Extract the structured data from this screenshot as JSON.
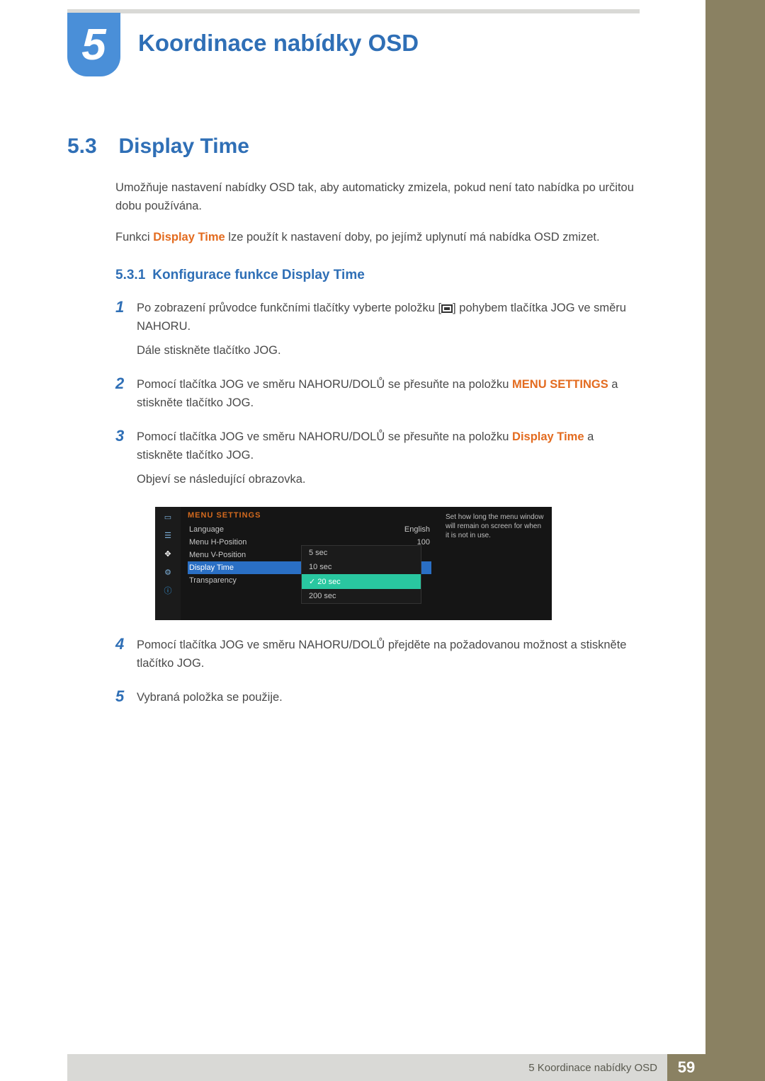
{
  "chapter": {
    "number": "5",
    "title": "Koordinace nabídky OSD"
  },
  "section": {
    "number": "5.3",
    "title": "Display Time",
    "intro1": "Umožňuje nastavení nabídky OSD tak, aby automaticky zmizela, pokud není tato nabídka po určitou dobu používána.",
    "intro2_prefix": "Funkci ",
    "intro2_accent": "Display Time",
    "intro2_suffix": " lze použít k nastavení doby, po jejímž uplynutí má nabídka OSD zmizet."
  },
  "subsection": {
    "number": "5.3.1",
    "title": "Konfigurace funkce Display Time"
  },
  "steps": [
    {
      "num": "1",
      "p1_a": "Po zobrazení průvodce funkčními tlačítky vyberte položku [",
      "p1_b": "] pohybem tlačítka JOG ve směru NAHORU.",
      "p2": "Dále stiskněte tlačítko JOG."
    },
    {
      "num": "2",
      "p1_a": "Pomocí tlačítka JOG ve směru NAHORU/DOLŮ se přesuňte na položku ",
      "accent": "MENU SETTINGS",
      "p1_b": " a stiskněte tlačítko JOG."
    },
    {
      "num": "3",
      "p1_a": "Pomocí tlačítka JOG ve směru NAHORU/DOLŮ se přesuňte na položku ",
      "accent": "Display Time",
      "p1_b": " a stiskněte tlačítko JOG.",
      "p2": "Objeví se následující obrazovka."
    },
    {
      "num": "4",
      "p1": "Pomocí tlačítka JOG ve směru NAHORU/DOLŮ přejděte na požadovanou možnost a stiskněte tlačítko JOG."
    },
    {
      "num": "5",
      "p1": "Vybraná položka se použije."
    }
  ],
  "osd": {
    "title": "MENU SETTINGS",
    "rows": [
      {
        "label": "Language",
        "value": "English"
      },
      {
        "label": "Menu H-Position",
        "value": "100"
      },
      {
        "label": "Menu V-Position",
        "value": ""
      },
      {
        "label": "Display Time",
        "value": ""
      },
      {
        "label": "Transparency",
        "value": ""
      }
    ],
    "active_index": 3,
    "popup": [
      "5 sec",
      "10 sec",
      "20 sec",
      "200 sec"
    ],
    "popup_selected_index": 2,
    "help": "Set how long the menu window will remain on screen for when it is not in use."
  },
  "footer": {
    "text": "5 Koordinace nabídky OSD",
    "page": "59"
  }
}
